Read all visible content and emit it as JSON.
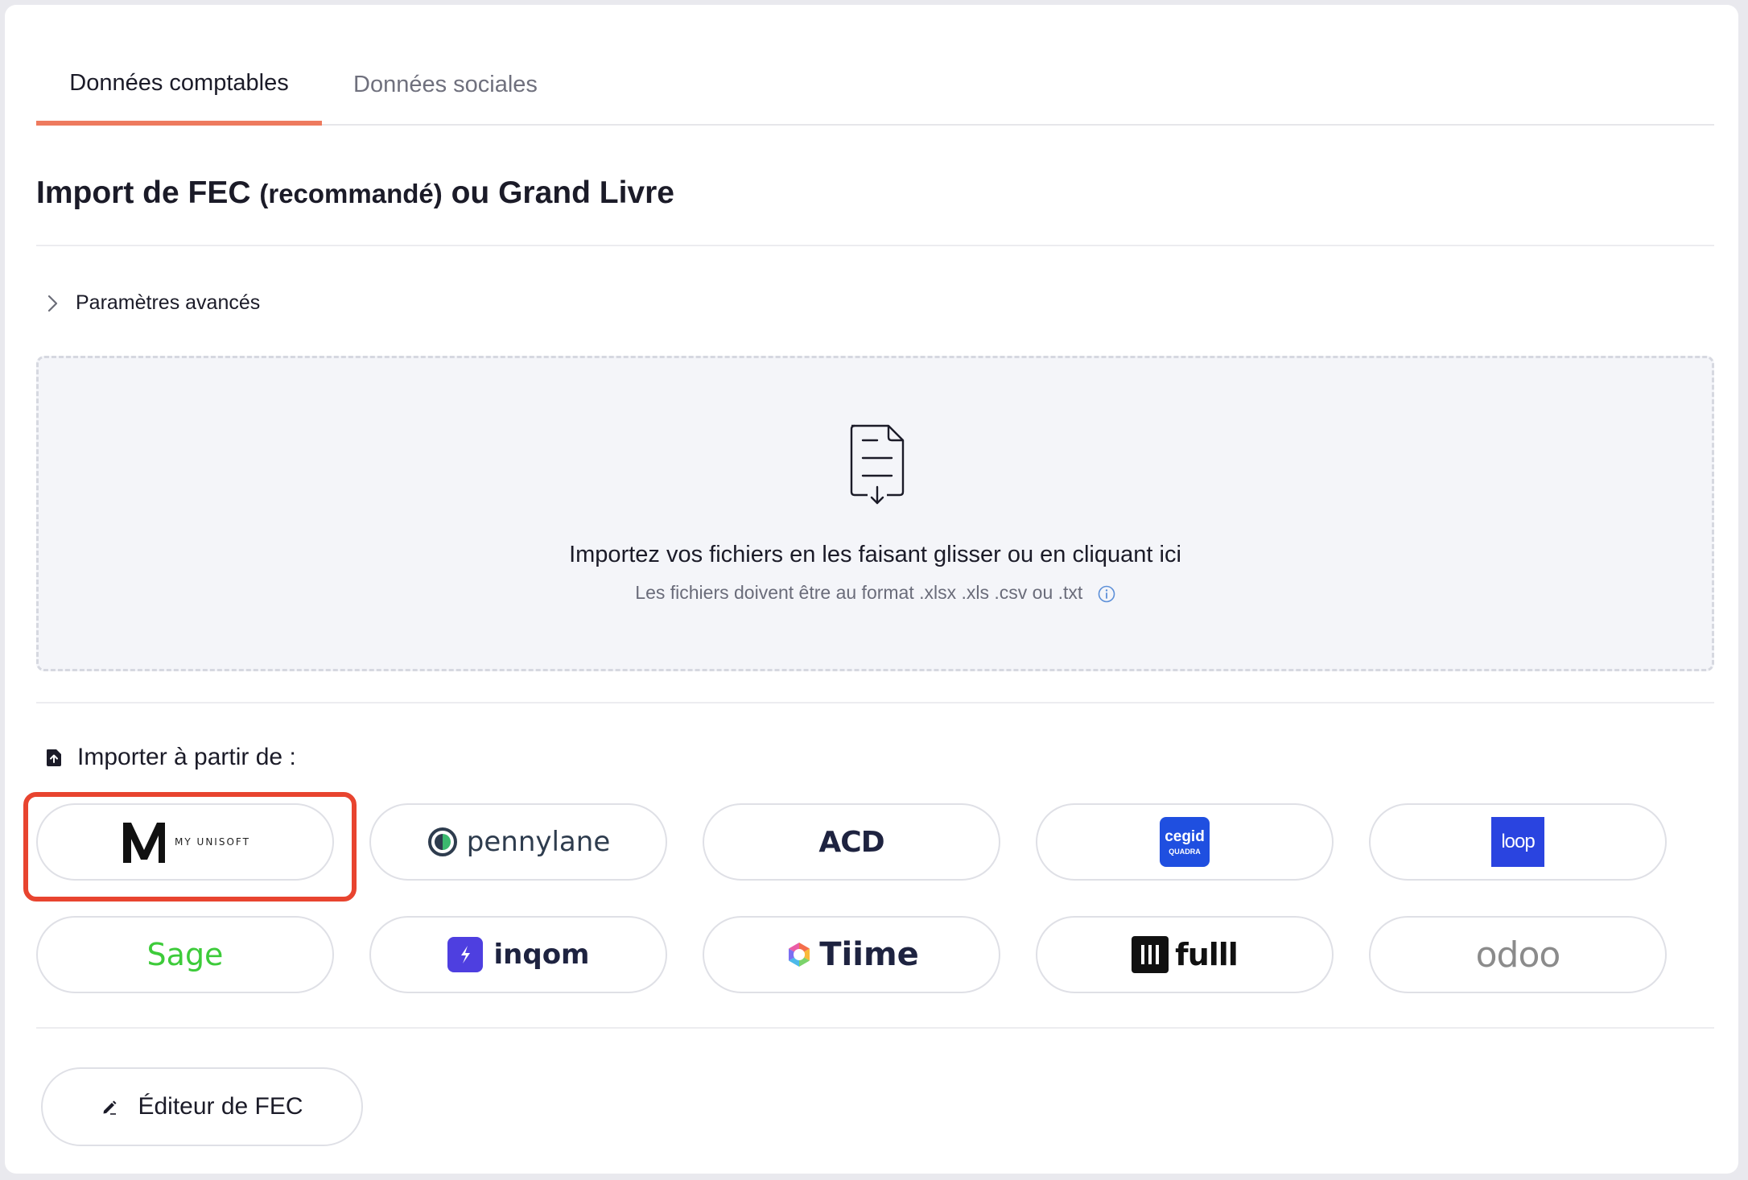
{
  "tabs": [
    {
      "label": "Données comptables",
      "active": true
    },
    {
      "label": "Données sociales",
      "active": false
    }
  ],
  "title": {
    "main": "Import de FEC",
    "paren": "(recommandé)",
    "rest": "ou Grand Livre"
  },
  "advanced": {
    "label": "Paramètres avancés",
    "icon": "chevron-right-icon"
  },
  "dropzone": {
    "main_text": "Importez vos fichiers en les faisant glisser ou en cliquant ici",
    "sub_text": "Les fichiers doivent être au format .xlsx .xls .csv ou .txt",
    "icon": "file-download-icon"
  },
  "import_from": {
    "label": "Importer à partir de :",
    "icon": "file-upload-icon"
  },
  "providers": [
    {
      "id": "myunisoft",
      "name": "MY UNISOFT",
      "selected": true
    },
    {
      "id": "pennylane",
      "name": "pennylane"
    },
    {
      "id": "acd",
      "name": "ACD"
    },
    {
      "id": "cegid",
      "name": "cegid",
      "sub": "QUADRA"
    },
    {
      "id": "loop",
      "name": "loop"
    },
    {
      "id": "sage",
      "name": "Sage"
    },
    {
      "id": "inqom",
      "name": "inqom"
    },
    {
      "id": "tiime",
      "name": "Tiime"
    },
    {
      "id": "fulll",
      "name": "fulll"
    },
    {
      "id": "odoo",
      "name": "odoo"
    }
  ],
  "editor": {
    "label": "Éditeur de FEC",
    "icon": "pen-icon"
  },
  "colors": {
    "accent": "#ee7a5e",
    "highlight": "#e8442f",
    "cegid": "#1f4fe0",
    "loop": "#2a44e0",
    "sage": "#3dcb3a",
    "inqom": "#4e3fe0",
    "odoo": "#8b5a7c"
  }
}
